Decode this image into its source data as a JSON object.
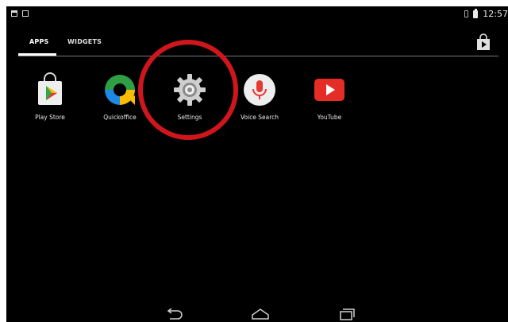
{
  "status_bar": {
    "time": "12:57"
  },
  "tabs": [
    {
      "label": "APPS",
      "selected": true
    },
    {
      "label": "WIDGETS",
      "selected": false
    }
  ],
  "apps": [
    {
      "label": "Play Store",
      "icon": "play-store-icon"
    },
    {
      "label": "Quickoffice",
      "icon": "quickoffice-icon"
    },
    {
      "label": "Settings",
      "icon": "settings-gear-icon"
    },
    {
      "label": "Voice Search",
      "icon": "microphone-icon"
    },
    {
      "label": "YouTube",
      "icon": "youtube-icon"
    }
  ],
  "colors": {
    "background": "#000000",
    "highlight_ring": "#d0161d",
    "youtube_red": "#e52d27",
    "voice_red": "#e53935"
  }
}
